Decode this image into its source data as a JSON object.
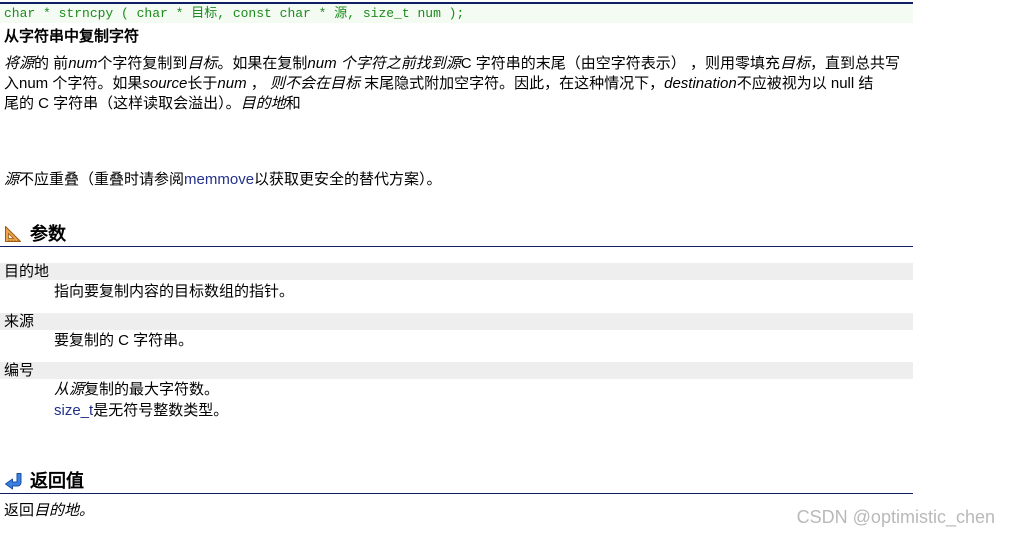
{
  "prototype": "char * strncpy ( char * 目标, const char * 源, size_t num );",
  "summary": "从字符串中复制字符",
  "description": {
    "lines": [
      [
        "将源",
        "的 前",
        "num",
        "个字符复制到",
        "目标",
        "。如果在复制",
        "num 个字符之前找到源",
        "C 字符串的末尾（由空字符表示） ，则用零填充",
        "目标",
        "，直到总共写"
      ],
      [
        "入num 个字符。如果",
        "source",
        "长于",
        "num",
        " ， ",
        "则不会在目标",
        " 末尾隐式附加空字符。因此，在这种情况下，",
        "destination",
        "不应被视为以 null 结"
      ],
      [
        "尾的 C 字符串（这样读取会溢出）。",
        "目的地",
        "和"
      ]
    ]
  },
  "overlap_note": [
    "源",
    "不应重叠（重叠时请参阅",
    "memmove",
    "以获取更安全的替代方案）。"
  ],
  "parameters": {
    "title": "参数",
    "icon": "set-square-icon",
    "items": [
      {
        "name": "目的地",
        "description": [
          [
            "指向要复制内容的目标数组的指针。"
          ]
        ]
      },
      {
        "name": "来源",
        "description": [
          [
            "要复制的 C 字符串。"
          ]
        ]
      },
      {
        "name": "编号",
        "description": [
          [
            "从源",
            "复制的最大字符数。"
          ],
          [
            "size_t",
            "是无符号整数类型。"
          ]
        ]
      }
    ]
  },
  "return_value": {
    "title": "返回值",
    "icon": "return-arrow-icon",
    "text": [
      "返回",
      "目的地。"
    ]
  },
  "watermark": "CSDN @optimistic_chen",
  "colors": {
    "rule": "#0f1f63",
    "prototype_background": "#f3fbf3",
    "prototype_text": "#1d8b1d",
    "link": "#23318a",
    "parameter_bar": "#eeeeee",
    "watermark": "#b9b9b9"
  }
}
